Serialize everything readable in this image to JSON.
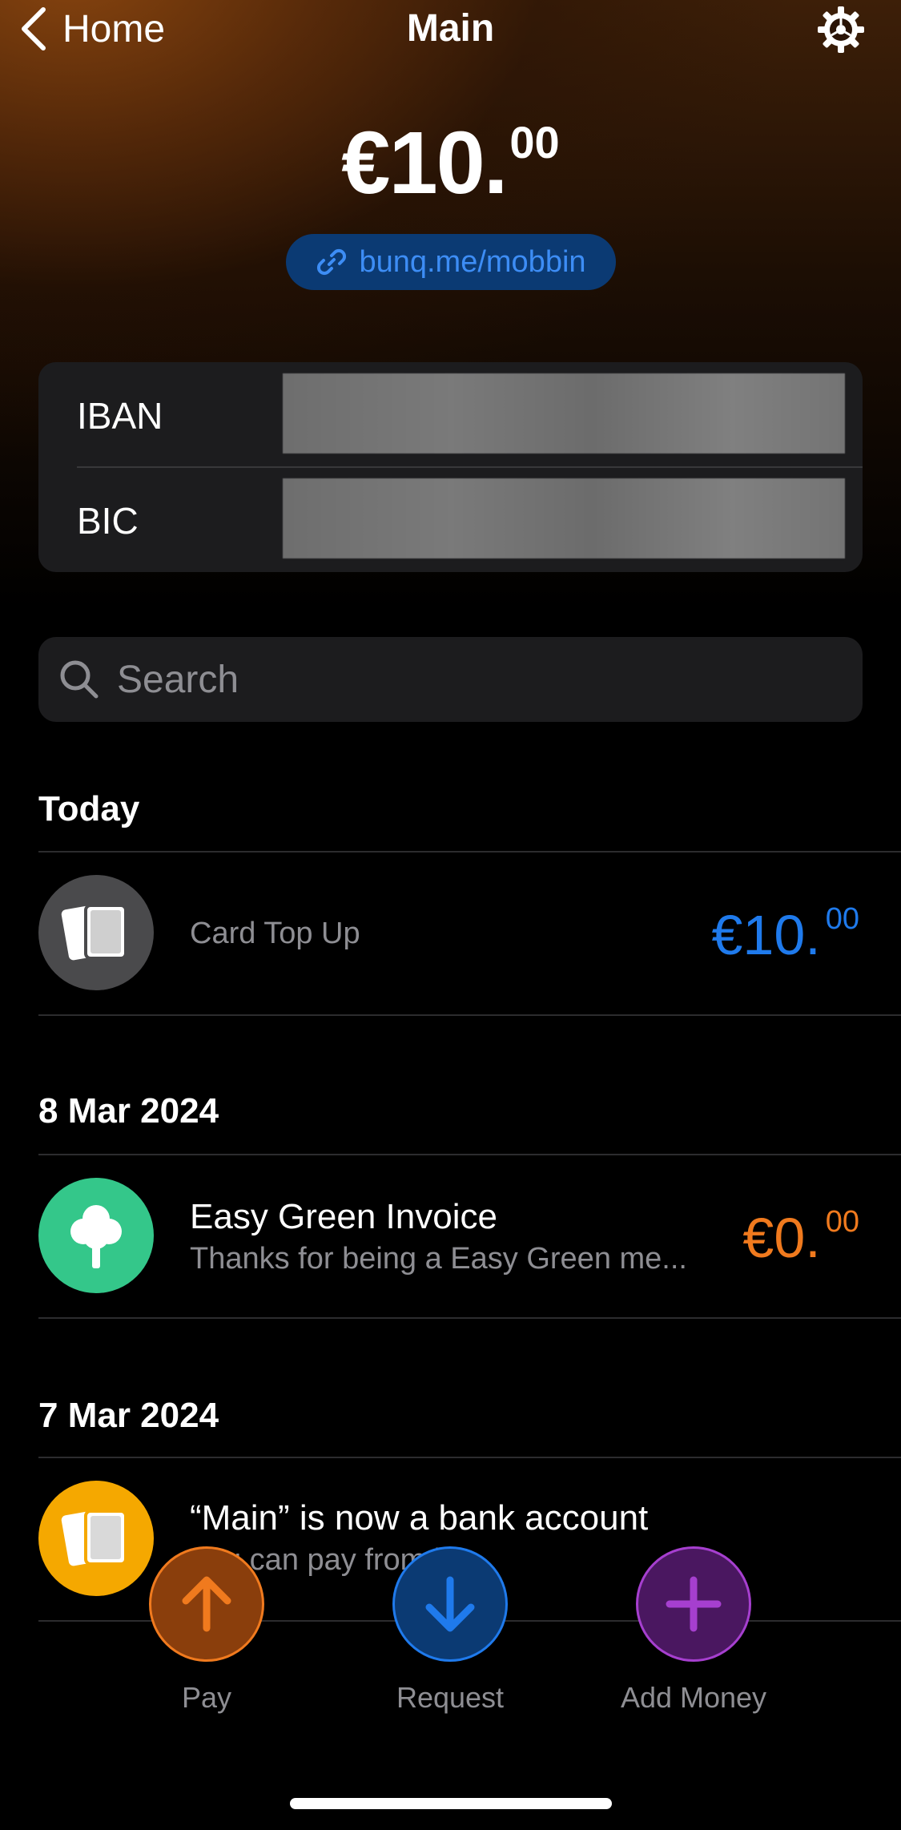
{
  "nav": {
    "back_label": "Home",
    "title": "Main"
  },
  "balance": {
    "main": "€10.",
    "cents": "00"
  },
  "link": {
    "label": "bunq.me/mobbin"
  },
  "bank": {
    "iban_label": "IBAN",
    "bic_label": "BIC"
  },
  "search": {
    "placeholder": "Search"
  },
  "sections": [
    {
      "date": "Today",
      "transactions": [
        {
          "title": "",
          "subtitle": "Card Top Up",
          "amount_main": "€10.",
          "amount_cents": "00",
          "color": "#1f7aec",
          "avatar_color": "#4a4a4c",
          "icon": "cards-icon"
        }
      ]
    },
    {
      "date": "8 Mar 2024",
      "transactions": [
        {
          "title": "Easy Green Invoice",
          "subtitle": "Thanks for being a Easy Green me...",
          "amount_main": "€0.",
          "amount_cents": "00",
          "color": "#f07a1e",
          "avatar_color": "#34c78a",
          "icon": "tree-icon"
        }
      ]
    },
    {
      "date": "7 Mar 2024",
      "transactions": [
        {
          "title": "“Main” is now a bank account",
          "subtitle": "You can pay from it!",
          "amount_main": "",
          "amount_cents": "",
          "color": "#ffffff",
          "avatar_color": "#f5a800",
          "icon": "cards-icon"
        }
      ]
    }
  ],
  "actions": {
    "pay_label": "Pay",
    "request_label": "Request",
    "add_money_label": "Add Money"
  },
  "colors": {
    "pay": "#f07a1e",
    "request": "#1f7aec",
    "add_money": "#a63fcf"
  }
}
